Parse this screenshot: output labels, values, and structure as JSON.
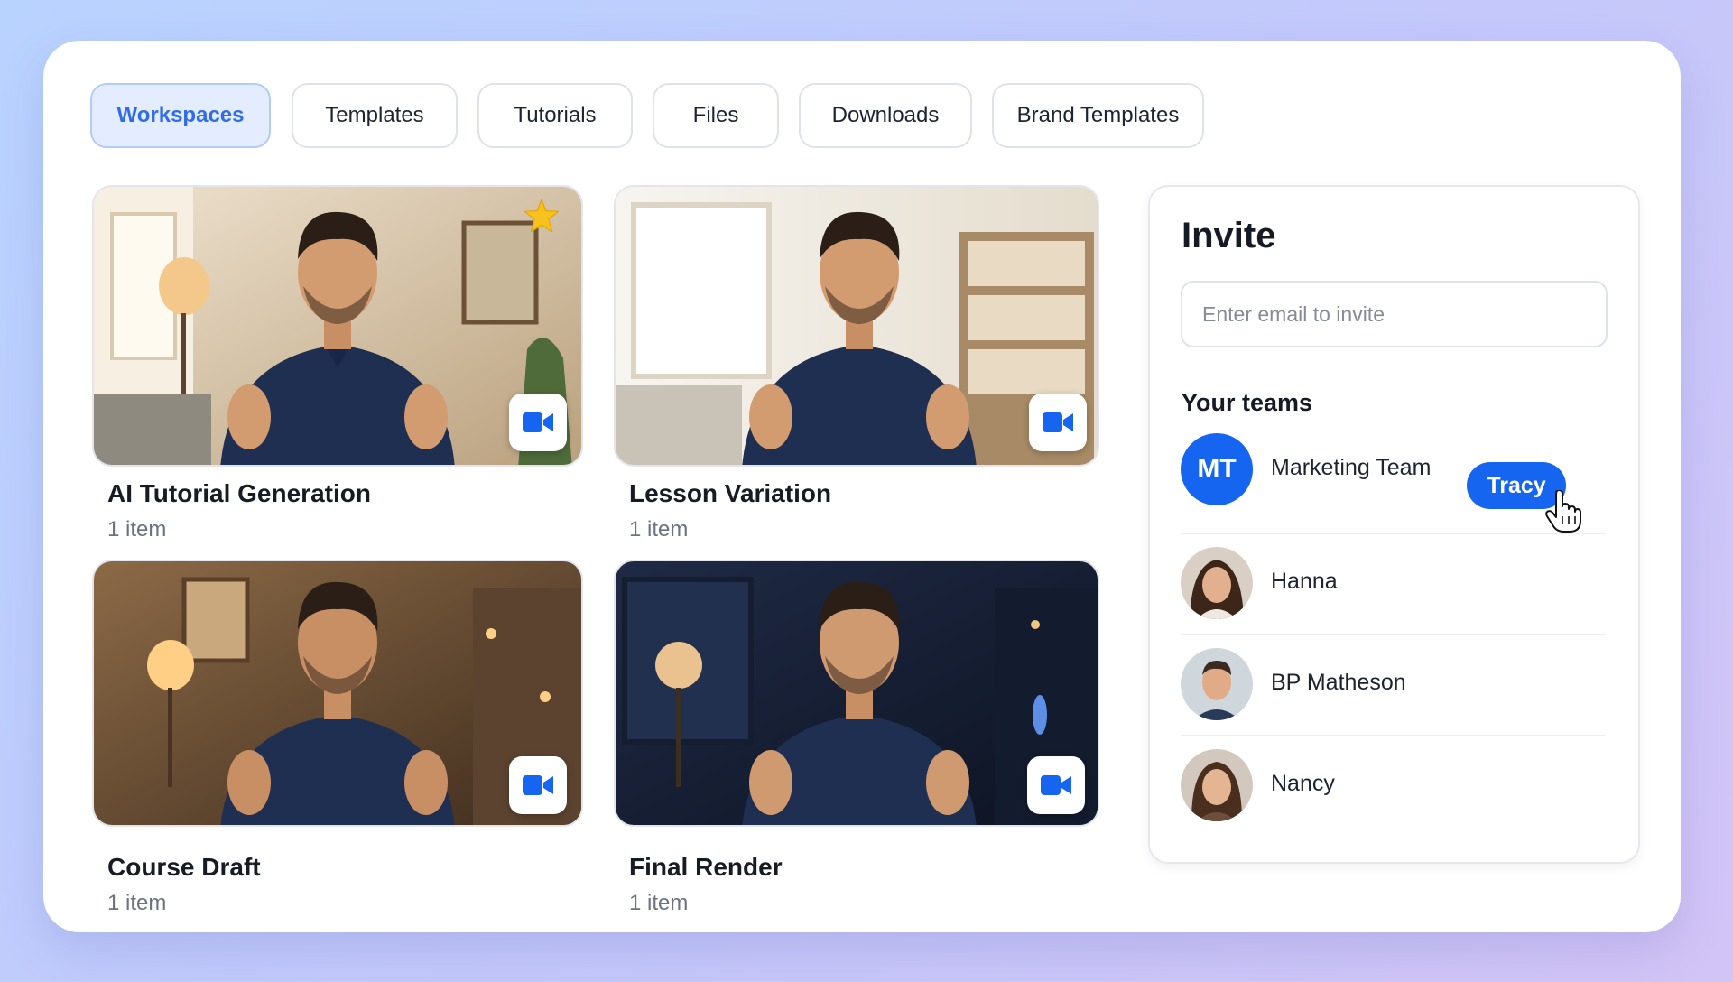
{
  "tabs": [
    {
      "label": "Workspaces",
      "active": true
    },
    {
      "label": "Templates",
      "active": false
    },
    {
      "label": "Tutorials",
      "active": false
    },
    {
      "label": "Files",
      "active": false
    },
    {
      "label": "Downloads",
      "active": false
    },
    {
      "label": "Brand Templates",
      "active": false
    }
  ],
  "workspaces": [
    {
      "title": "AI Tutorial Generation",
      "count": "1 item",
      "starred": true,
      "scene": "warm living room, daylight",
      "icon": "video-camera-icon"
    },
    {
      "title": "Lesson Variation",
      "count": "1 item",
      "starred": false,
      "scene": "bright room with bookshelf",
      "icon": "video-camera-icon"
    },
    {
      "title": "Course Draft",
      "count": "1 item",
      "starred": false,
      "scene": "cozy lamp-lit room",
      "icon": "video-camera-icon"
    },
    {
      "title": "Final Render",
      "count": "1 item",
      "starred": false,
      "scene": "dark night room",
      "icon": "video-camera-icon"
    }
  ],
  "invite": {
    "title": "Invite",
    "email_placeholder": "Enter email to invite",
    "email_value": "",
    "teams_heading": "Your teams",
    "teams": [
      {
        "initials": "MT",
        "name": "Marketing Team",
        "action": "Tracy"
      },
      {
        "name": "Hanna"
      },
      {
        "name": "BP Matheson"
      },
      {
        "name": "Nancy"
      }
    ]
  },
  "colors": {
    "accent": "#1565f0",
    "active_tab_bg": "#e4edff",
    "active_tab_text": "#2f6bea",
    "star": "#f7c21e"
  }
}
